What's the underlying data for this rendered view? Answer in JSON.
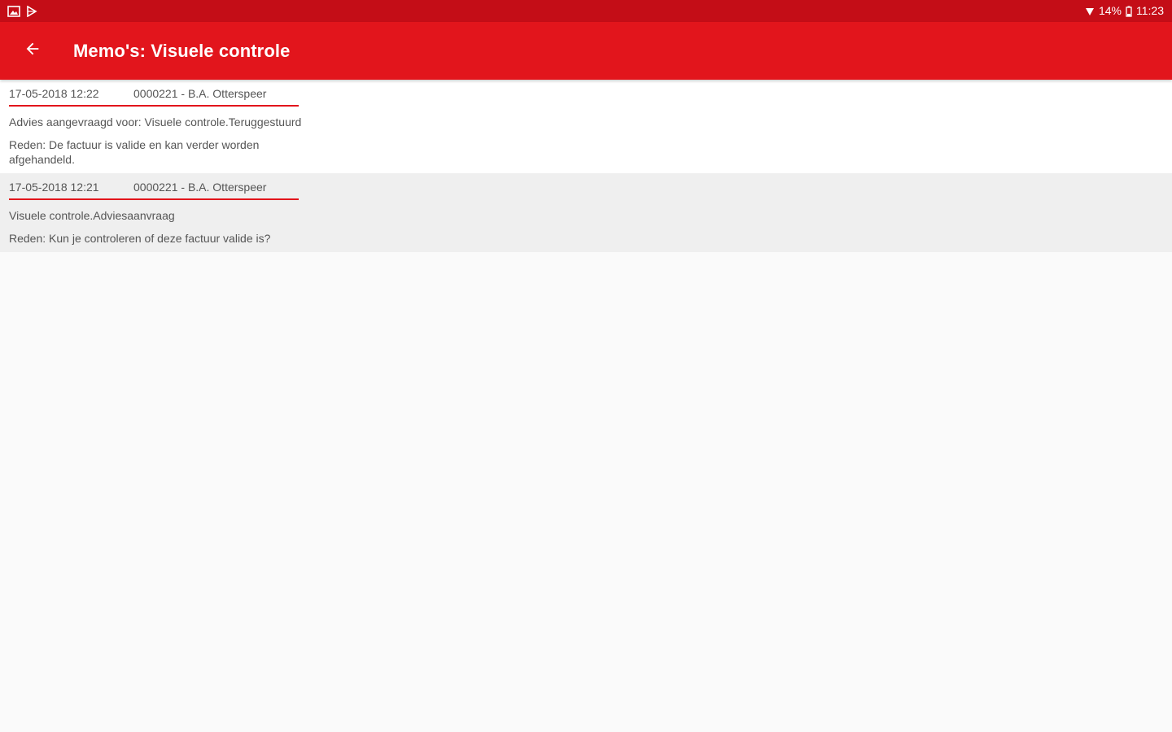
{
  "status_bar": {
    "battery": "14%",
    "time": "11:23"
  },
  "header": {
    "title": "Memo's: Visuele controle"
  },
  "memos": [
    {
      "date": "17-05-2018 12:22",
      "author": "0000221 - B.A. Otterspeer",
      "text": "Advies aangevraagd voor: Visuele controle.Teruggestuurd",
      "reason": "Reden: De factuur is valide en kan verder worden afgehandeld."
    },
    {
      "date": "17-05-2018 12:21",
      "author": "0000221 - B.A. Otterspeer",
      "text": "Visuele controle.Adviesaanvraag",
      "reason": "Reden: Kun je controleren of deze factuur valide is?"
    }
  ],
  "colors": {
    "status_bar": "#c40d17",
    "app_bar": "#e2151c",
    "divider": "#e2151c",
    "list_even": "#efefef"
  }
}
